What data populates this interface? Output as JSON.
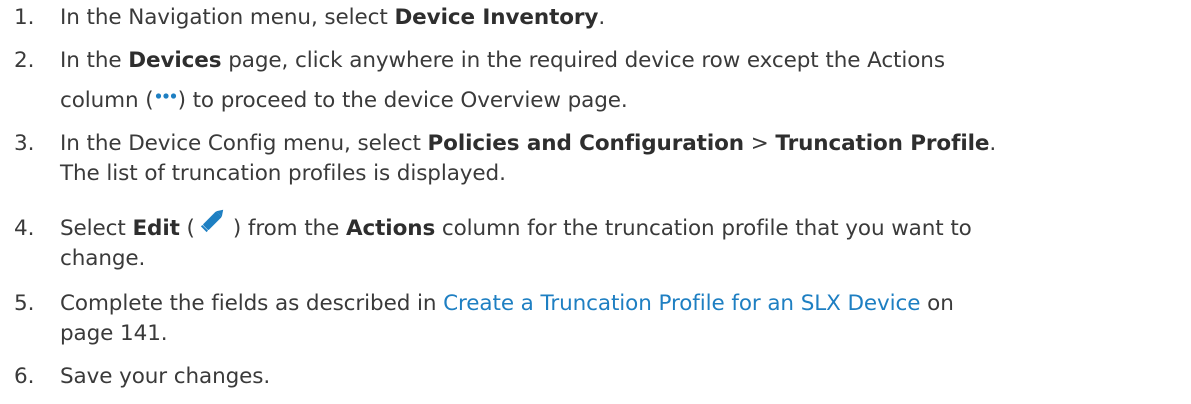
{
  "steps": [
    {
      "num": "1.",
      "t1": "In the Navigation menu, select ",
      "b1": "Device Inventory",
      "t2": "."
    },
    {
      "num": "2.",
      "t1": "In the ",
      "b1": "Devices",
      "t2": " page, click anywhere in the required device row except the Actions",
      "t3": "column (",
      "t4": ") to proceed to the device Overview page."
    },
    {
      "num": "3.",
      "t1": "In the Device Config menu, select ",
      "b1": "Policies and Configuration",
      "t2": " > ",
      "b2": "Truncation Profile",
      "t3": ".",
      "t4": "The list of truncation profiles is displayed."
    },
    {
      "num": "4.",
      "t1": "Select ",
      "b1": "Edit",
      "t2": " (",
      "t3": ") from the ",
      "b2": "Actions",
      "t4": " column for the truncation profile that you want to",
      "t5": "change."
    },
    {
      "num": "5.",
      "t1": "Complete the fields as described in ",
      "link": "Create a Truncation Profile for an SLX Device",
      "t2": " on",
      "t3": "page 141."
    },
    {
      "num": "6.",
      "t1": "Save your changes."
    }
  ],
  "colors": {
    "text": "#3a3a3a",
    "link": "#1e7fc2",
    "icon": "#1e7fc2"
  },
  "icons": {
    "actions": "more-dots-icon",
    "edit": "pencil-icon"
  }
}
